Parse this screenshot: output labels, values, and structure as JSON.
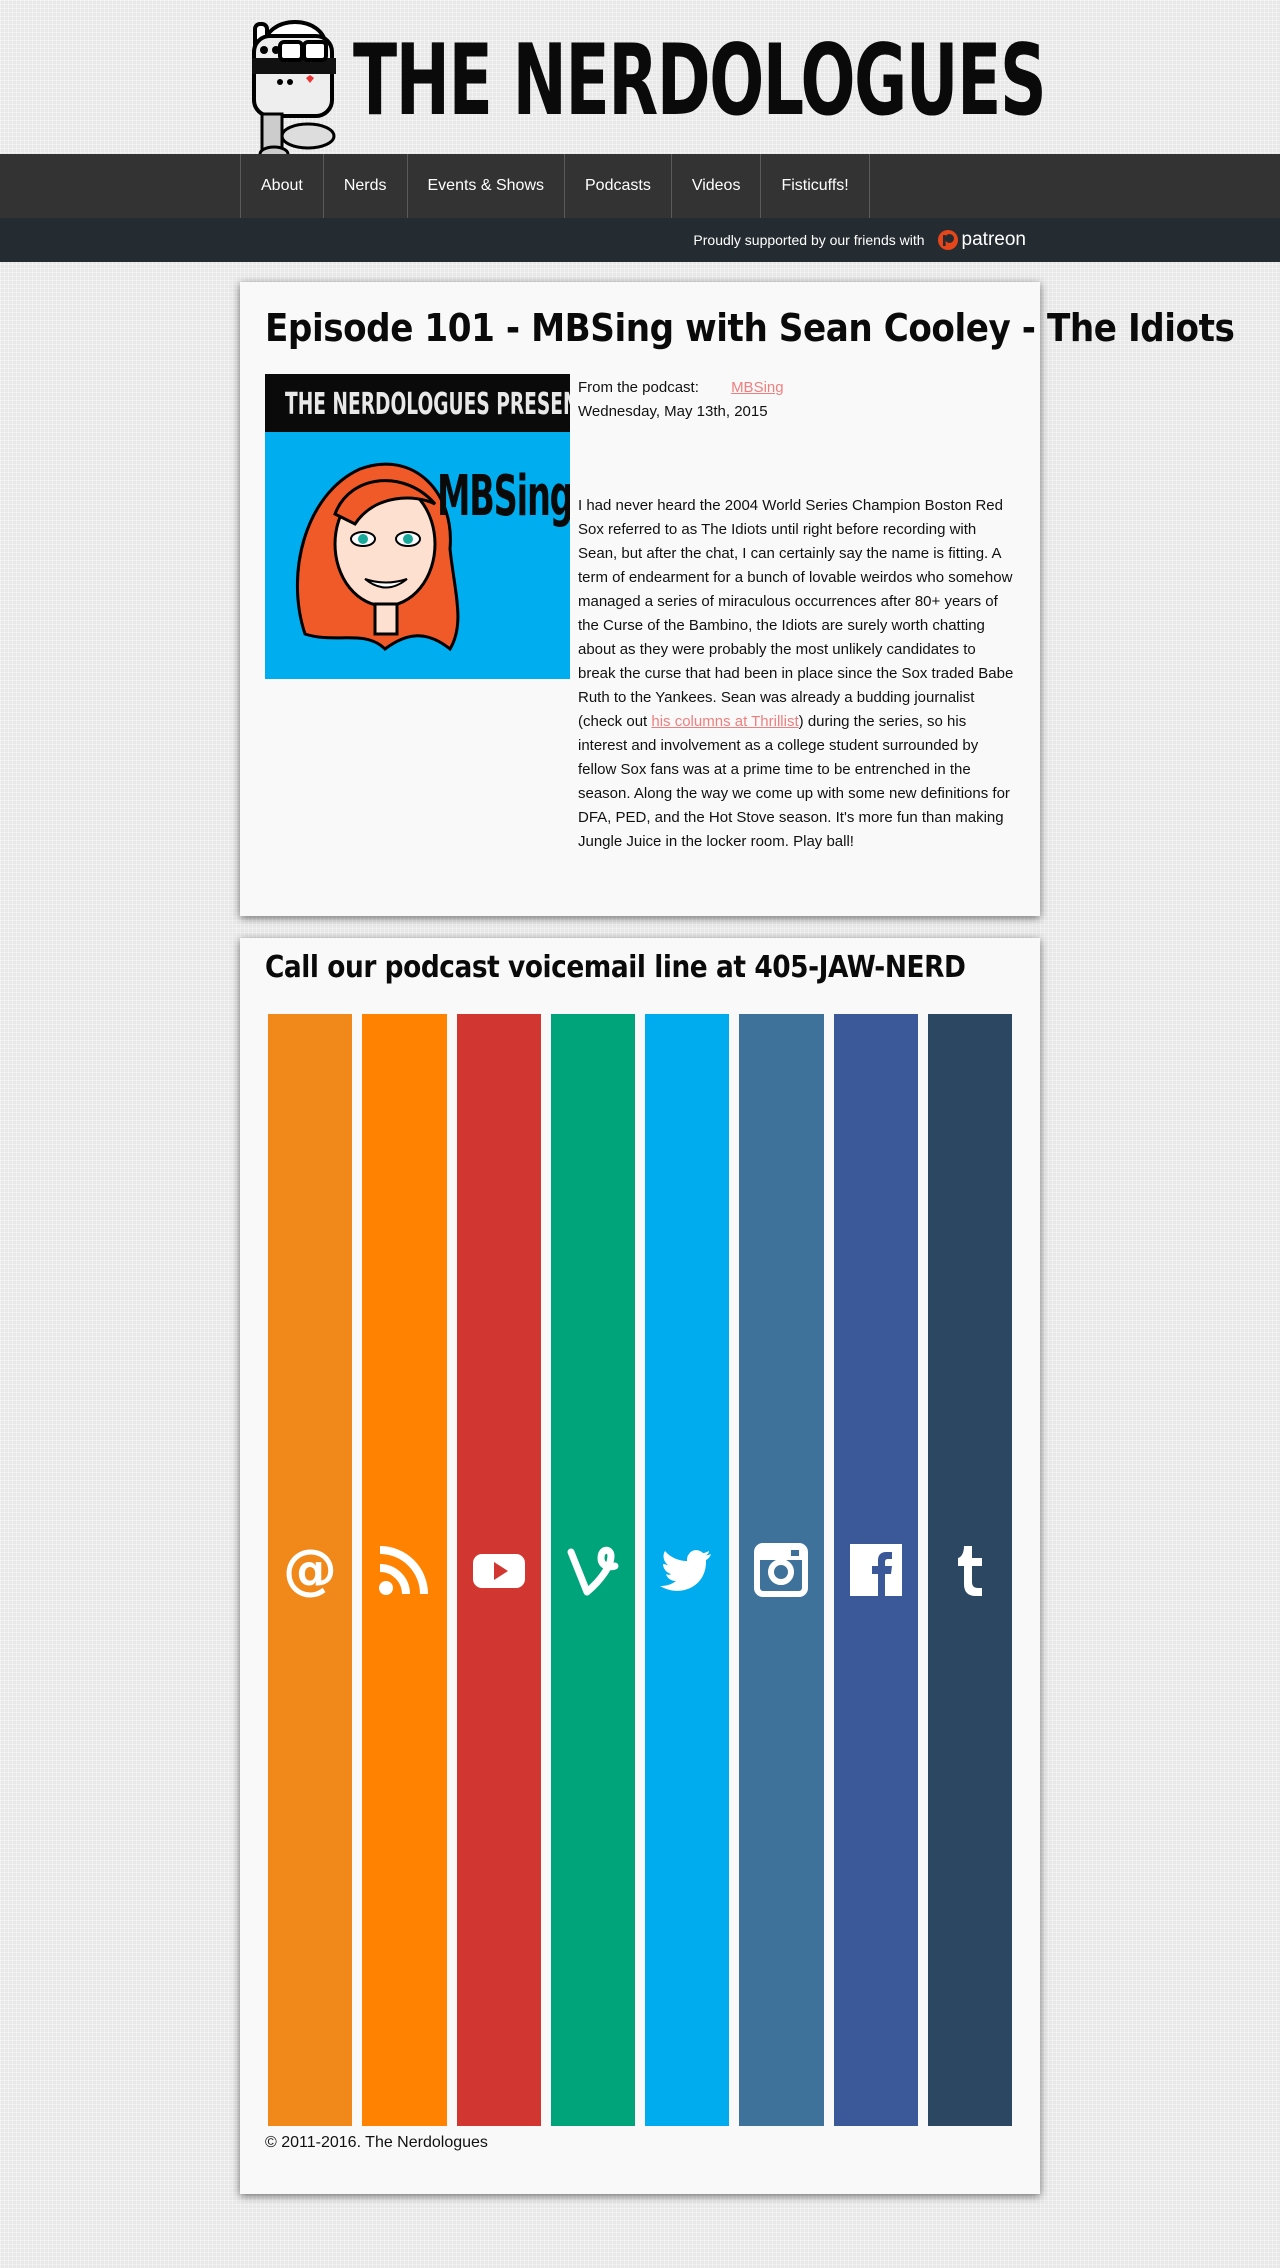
{
  "site": {
    "title": "THE NERDOLOGUES"
  },
  "nav": {
    "items": [
      {
        "label": "About"
      },
      {
        "label": "Nerds"
      },
      {
        "label": "Events & Shows"
      },
      {
        "label": "Podcasts"
      },
      {
        "label": "Videos"
      },
      {
        "label": "Fisticuffs!"
      }
    ]
  },
  "patreon": {
    "text": "Proudly supported by our friends with",
    "brand": "patreon"
  },
  "episode": {
    "title": "Episode 101 - MBSing with Sean Cooley - The Idiots",
    "cover_header": "THE NERDOLOGUES PRESENTS",
    "cover_show": "MBSing",
    "from_label": "From the podcast:",
    "podcast_link": "MBSing",
    "date": "Wednesday, May 13th, 2015",
    "description_before": "I had never heard the 2004 World Series Champion Boston Red Sox referred to as The Idiots until right before recording with Sean, but after the chat, I can certainly say the name is fitting. A term of endearment for a bunch of lovable weirdos who somehow managed a series of miraculous occurrences after 80+ years of the Curse of the Bambino, the Idiots are surely worth chatting about as they were probably the most unlikely candidates to break the curse that had been in place since the Sox traded Babe Ruth to the Yankees. Sean was already a budding journalist (check out ",
    "description_link": "his columns at Thrillist",
    "description_after": ") during the series, so his interest and involvement as a college student surrounded by fellow Sox fans was at a prime time to be entrenched in the season. Along the way we come up with some new definitions for DFA, PED, and the Hot Stove season. It's more fun than making Jungle Juice in the locker room. Play ball!"
  },
  "voicemail": {
    "title": "Call our podcast voicemail line at 405-JAW-NERD"
  },
  "socials": [
    {
      "icon": "email-icon",
      "color": "#f0891a"
    },
    {
      "icon": "rss-icon",
      "color": "#ff8200"
    },
    {
      "icon": "youtube-icon",
      "color": "#d23630"
    },
    {
      "icon": "vine-icon",
      "color": "#00a47a"
    },
    {
      "icon": "twitter-icon",
      "color": "#00aced"
    },
    {
      "icon": "instagram-icon",
      "color": "#3f729b"
    },
    {
      "icon": "facebook-icon",
      "color": "#3b5998"
    },
    {
      "icon": "tumblr-icon",
      "color": "#2c4762"
    }
  ],
  "footer": {
    "copyright": "© 2011-2016. The Nerdologues"
  }
}
